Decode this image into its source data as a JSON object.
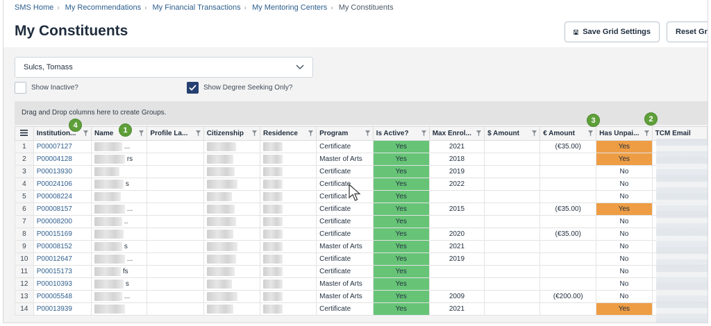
{
  "breadcrumb": {
    "items": [
      "SMS Home",
      "My Recommendations",
      "My Financial Transactions",
      "My Mentoring Centers"
    ],
    "current": "My Constituents"
  },
  "page_title": "My Constituents",
  "buttons": {
    "save_grid": "Save Grid Settings",
    "reset_grid": "Reset Gric"
  },
  "filter": {
    "selected": "Sulcs, Tomass",
    "show_inactive_label": "Show Inactive?",
    "show_inactive_checked": false,
    "show_degree_label": "Show Degree Seeking Only?",
    "show_degree_checked": true
  },
  "group_bar_text": "Drag and Drop columns here to create Groups.",
  "callouts": [
    "1",
    "2",
    "3",
    "4"
  ],
  "columns": [
    "Institution...",
    "Name",
    "Profile La...",
    "Citizenship",
    "Residence",
    "Program",
    "Is Active?",
    "Max Enrol...",
    "$ Amount",
    "€ Amount",
    "Has Unpai...",
    "TCM Email"
  ],
  "rows": [
    {
      "n": "1",
      "id": "P00007127",
      "program": "Certificate",
      "active": "Yes",
      "year": "2021",
      "usd": "",
      "eur": "(€35.00)",
      "unpaid": "Yes",
      "name_tail": "..."
    },
    {
      "n": "2",
      "id": "P00004128",
      "program": "Master of Arts",
      "active": "Yes",
      "year": "2018",
      "usd": "",
      "eur": "",
      "unpaid": "Yes",
      "name_tail": "rs"
    },
    {
      "n": "3",
      "id": "P00013930",
      "program": "Certificate",
      "active": "Yes",
      "year": "2019",
      "usd": "",
      "eur": "",
      "unpaid": "No",
      "name_tail": ""
    },
    {
      "n": "4",
      "id": "P00024106",
      "program": "Certificate",
      "active": "Yes",
      "year": "2022",
      "usd": "",
      "eur": "",
      "unpaid": "No",
      "name_tail": "s"
    },
    {
      "n": "5",
      "id": "P00008224",
      "program": "Certificat",
      "active": "Yes",
      "year": "",
      "usd": "",
      "eur": "",
      "unpaid": "No",
      "name_tail": ""
    },
    {
      "n": "6",
      "id": "P00008157",
      "program": "Certificate",
      "active": "Yes",
      "year": "2015",
      "usd": "",
      "eur": "(€35.00)",
      "unpaid": "Yes",
      "name_tail": "..."
    },
    {
      "n": "7",
      "id": "P00008200",
      "program": "Certificate",
      "active": "Yes",
      "year": "",
      "usd": "",
      "eur": "",
      "unpaid": "No",
      "name_tail": ".."
    },
    {
      "n": "8",
      "id": "P00015169",
      "program": "Certificate",
      "active": "Yes",
      "year": "2020",
      "usd": "",
      "eur": "(€35.00)",
      "unpaid": "No",
      "name_tail": ""
    },
    {
      "n": "9",
      "id": "P00008152",
      "program": "Master of Arts",
      "active": "Yes",
      "year": "2021",
      "usd": "",
      "eur": "",
      "unpaid": "No",
      "name_tail": "s"
    },
    {
      "n": "10",
      "id": "P00012647",
      "program": "Certificate",
      "active": "Yes",
      "year": "2019",
      "usd": "",
      "eur": "",
      "unpaid": "No",
      "name_tail": "..."
    },
    {
      "n": "11",
      "id": "P00015173",
      "program": "Certificate",
      "active": "Yes",
      "year": "",
      "usd": "",
      "eur": "",
      "unpaid": "No",
      "name_tail": "fs"
    },
    {
      "n": "12",
      "id": "P00010393",
      "program": "Master of Arts",
      "active": "Yes",
      "year": "",
      "usd": "",
      "eur": "",
      "unpaid": "No",
      "name_tail": "s"
    },
    {
      "n": "13",
      "id": "P00005548",
      "program": "Master of Arts",
      "active": "Yes",
      "year": "2009",
      "usd": "",
      "eur": "(€200.00)",
      "unpaid": "No",
      "name_tail": "..."
    },
    {
      "n": "14",
      "id": "P00013939",
      "program": "Certificate",
      "active": "Yes",
      "year": "2021",
      "usd": "",
      "eur": "",
      "unpaid": "Yes",
      "name_tail": ""
    }
  ],
  "colors": {
    "active_green": "#67c477",
    "unpaid_orange": "#ee9d45",
    "link_blue": "#2f5f8f",
    "callout_green": "#5e9f3a"
  }
}
